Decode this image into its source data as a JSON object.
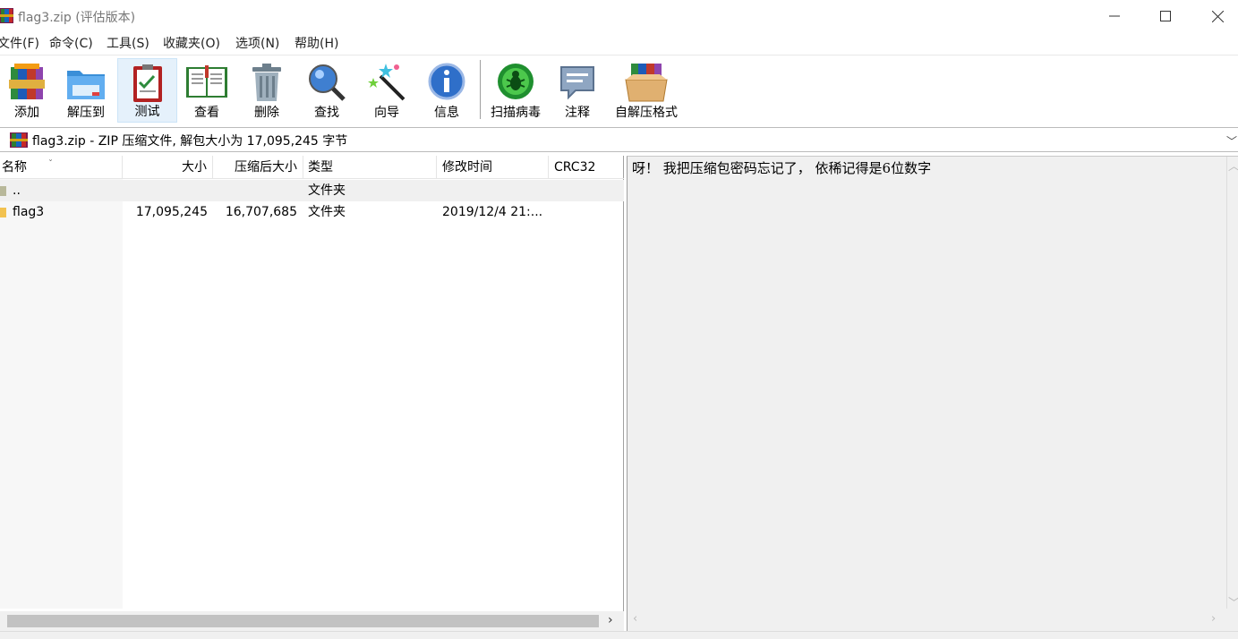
{
  "window": {
    "title": "flag3.zip (评估版本)"
  },
  "menu": [
    "文件(F)",
    "命令(C)",
    "工具(S)",
    "收藏夹(O)",
    "选项(N)",
    "帮助(H)"
  ],
  "toolbar": {
    "add": "添加",
    "extract_to": "解压到",
    "test": "测试",
    "view": "查看",
    "delete": "删除",
    "find": "查找",
    "wizard": "向导",
    "info": "信息",
    "virus_scan": "扫描病毒",
    "comment": "注释",
    "sfx": "自解压格式"
  },
  "address": {
    "text": "flag3.zip - ZIP 压缩文件, 解包大小为 17,095,245 字节"
  },
  "file_list": {
    "columns": {
      "name": "名称",
      "size": "大小",
      "packed": "压缩后大小",
      "type": "类型",
      "modified": "修改时间",
      "crc": "CRC32"
    },
    "rows": [
      {
        "name": "..",
        "size": "",
        "packed": "",
        "type": "文件夹",
        "modified": "",
        "crc": ""
      },
      {
        "name": "flag3",
        "size": "17,095,245",
        "packed": "16,707,685",
        "type": "文件夹",
        "modified": "2019/12/4 21:...",
        "crc": ""
      }
    ]
  },
  "comment": {
    "text": "呀！ 我把压缩包密码忘记了， 依稀记得是6位数字"
  },
  "colors": {
    "highlight_row": "#f0f0f0",
    "active_tool": "#e5f1fb",
    "comment_bg": "#f0f0f0"
  }
}
